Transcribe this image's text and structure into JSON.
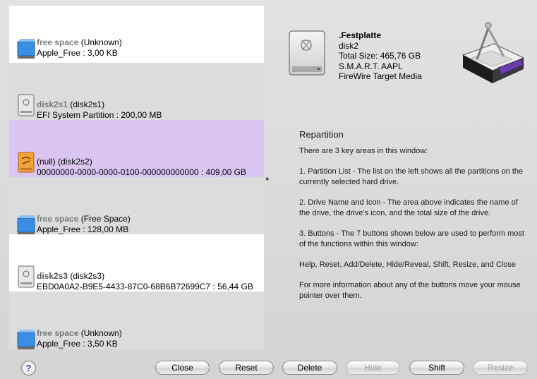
{
  "partitions": [
    {
      "name": "free space",
      "suffix": " (Unknown)",
      "detail": "Apple_Free : 3,00 KB",
      "icon": "blue-volume-icon",
      "style": "white",
      "selected": false
    },
    {
      "name": "disk2s1",
      "suffix": " (disk2s1)",
      "detail": "EFI System Partition : 200,00 MB",
      "icon": "firewire-drive-icon",
      "style": "gray",
      "selected": false
    },
    {
      "name": "(null)",
      "suffix": " (disk2s2)",
      "detail": "00000000-0000-0000-0100-000000000000 : 409,00 GB",
      "icon": "orange-volume-icon",
      "style": "selected",
      "selected": true
    },
    {
      "name": "free space",
      "suffix": " (Free Space)",
      "detail": "Apple_Free : 128,00 MB",
      "icon": "blue-volume-icon",
      "style": "gray",
      "selected": false
    },
    {
      "name": "disk2s3",
      "suffix": " (disk2s3)",
      "detail": "EBD0A0A2-B9E5-4433-87C0-68B6B72699C7 : 56,44 GB",
      "icon": "firewire-drive-icon",
      "style": "white",
      "selected": false
    },
    {
      "name": "free space",
      "suffix": " (Unknown)",
      "detail": "Apple_Free : 3,50 KB",
      "icon": "blue-volume-icon",
      "style": "gray",
      "selected": false
    }
  ],
  "drive": {
    "title": ".Festplatte",
    "device": "disk2",
    "size": "Total Size: 465,76 GB",
    "smart": "S.M.A.R.T. AAPL",
    "media": "FireWire Target Media",
    "icon": "firewire-drive-icon"
  },
  "help": {
    "title": "Repartition",
    "paragraphs": [
      "There are 3 key areas in this window:",
      "1. Partition List - The list on the left shows all the partitions on the currently selected hard drive.",
      "2. Drive Name and Icon - The area above indicates the name of the drive, the drive's icon, and the total size of the drive.",
      "3. Buttons - The 7 buttons shown below are used to perform most of the functions within this window:",
      "Help, Reset, Add/Delete, Hide/Reveal, Shift, Resize, and Close",
      "For more information about any of the buttons move your mouse pointer over them."
    ]
  },
  "toolbar": {
    "help_label": "?",
    "close_label": "Close",
    "reset_label": "Reset",
    "delete_label": "Delete",
    "hide_label": "Hide",
    "shift_label": "Shift",
    "resize_label": "Resize"
  },
  "colors": {
    "selected_row": "#dbc6f3",
    "gray_row": "#dcdcdc",
    "help_accent": "#4a2d8f"
  }
}
